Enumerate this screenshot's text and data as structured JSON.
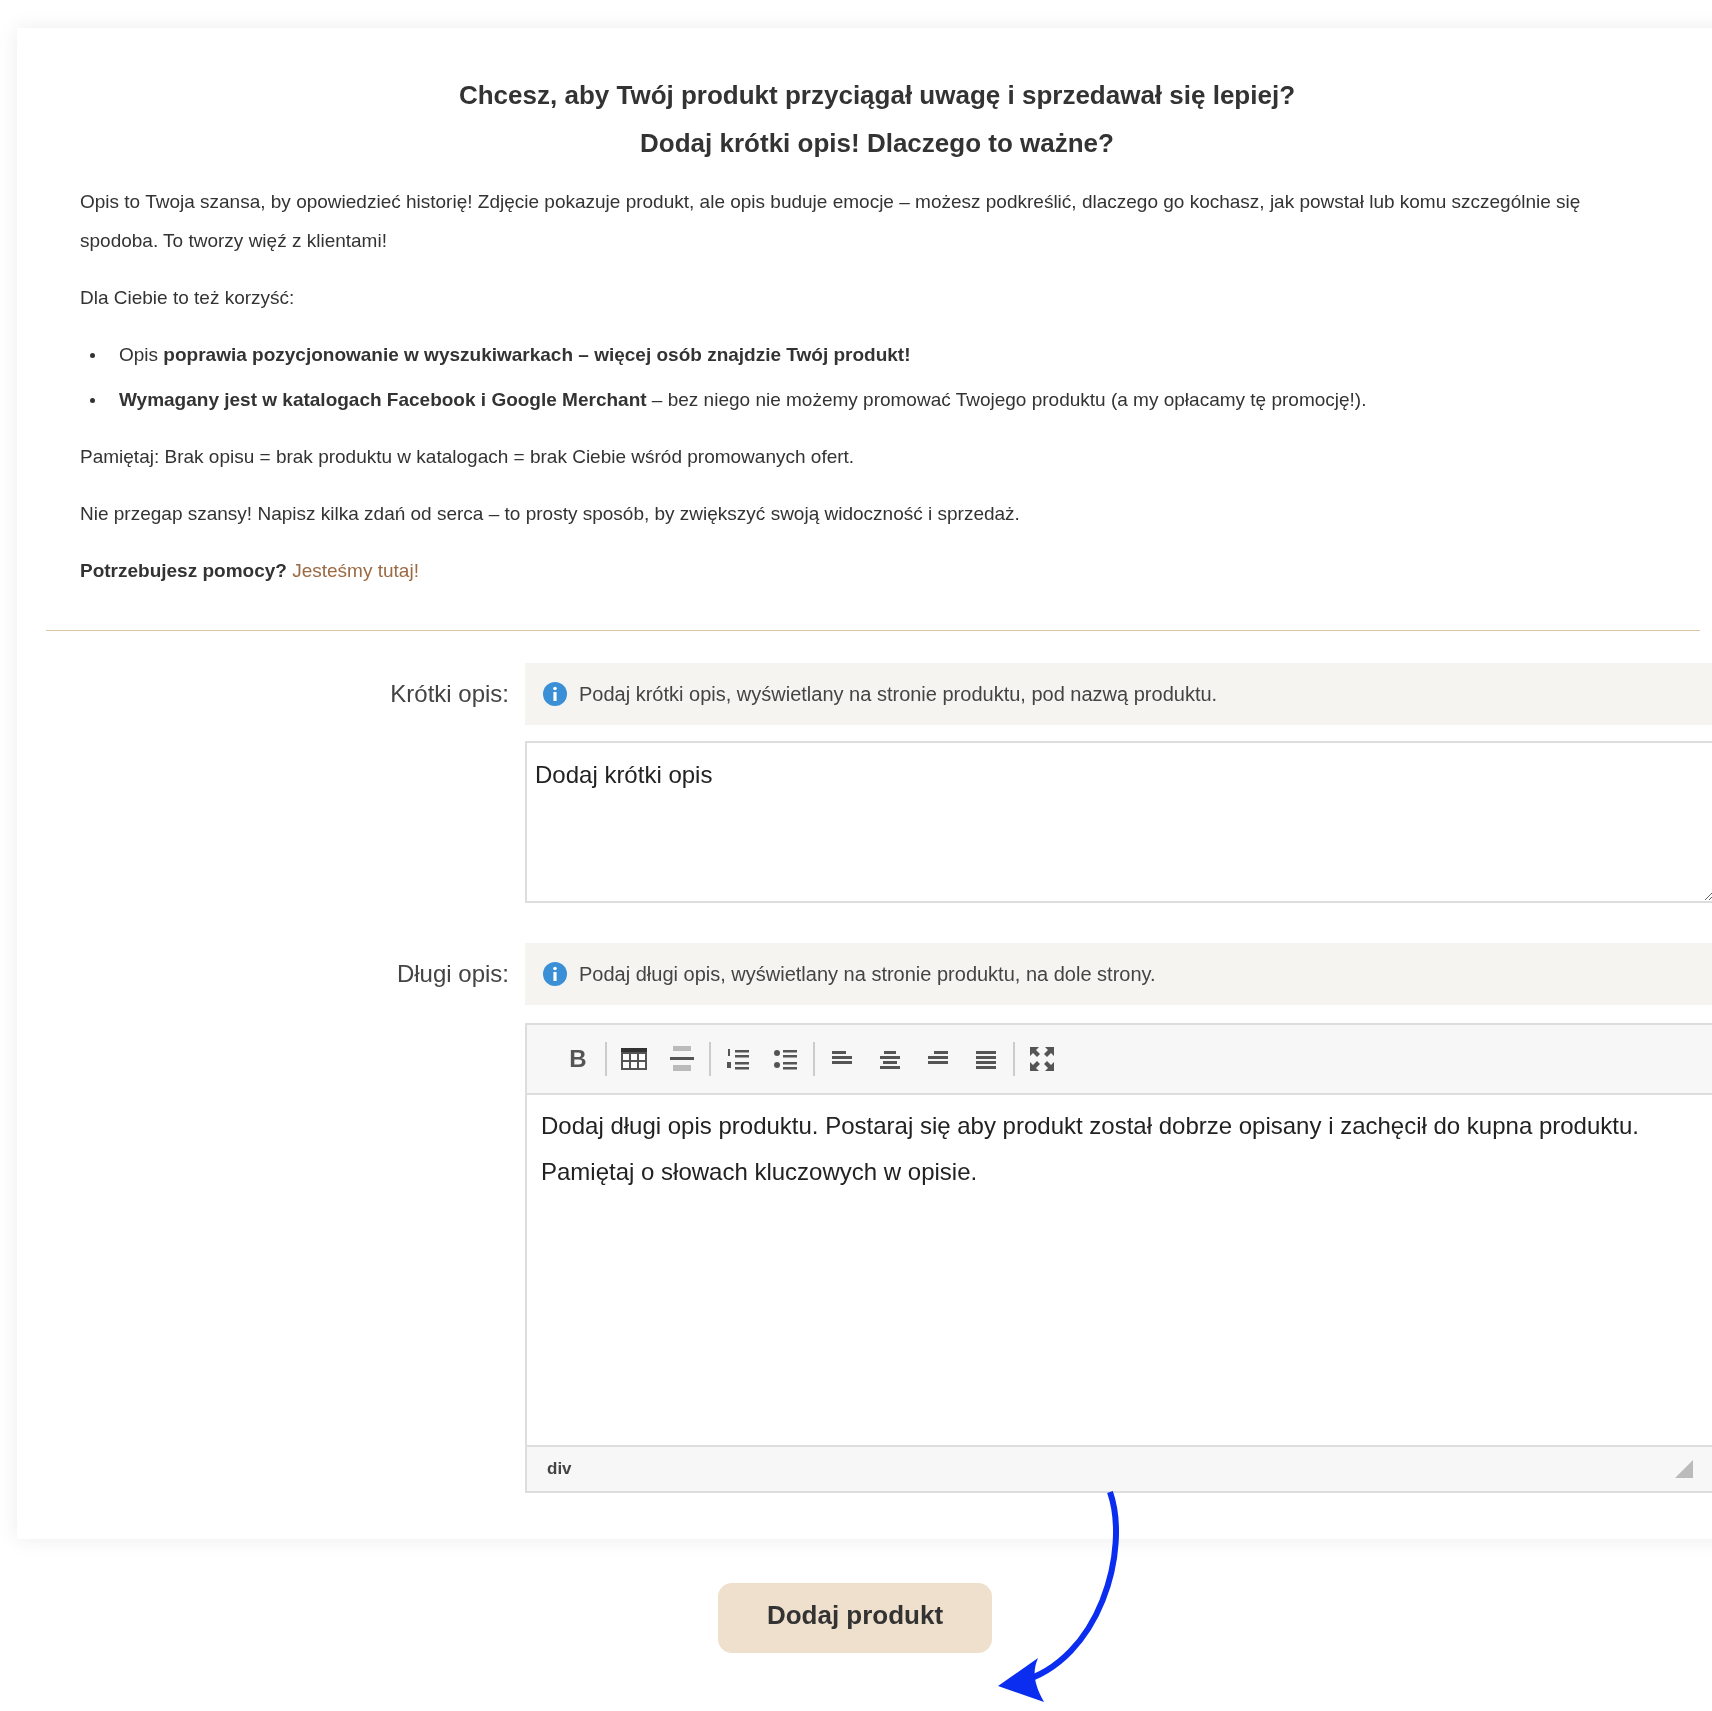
{
  "intro": {
    "heading_lines": [
      "Chcesz, aby Twój produkt przyciągał uwagę i sprzedawał się lepiej?",
      "Dodaj krótki opis! Dlaczego to ważne?"
    ],
    "paragraphs": [
      "Opis to Twoja szansa, by opowiedzieć historię! Zdjęcie pokazuje produkt, ale opis buduje emocje – możesz podkreślić, dlaczego go kochasz, jak powstał lub komu szczególnie się spodoba. To tworzy więź z klientami!",
      "Dla Ciebie to też korzyść:"
    ],
    "bullets": [
      "Opis **poprawia pozycjonowanie w wyszukiwarkach – więcej osób znajdzie Twój produkt!**",
      "**Wymagany jest w katalogach Facebook i Google Merchant** – bez niego nie możemy promować Twojego produktu (a my opłacamy tę promocję!)."
    ],
    "closing": [
      "Pamiętaj: Brak opisu = brak produktu w katalogach = brak Ciebie wśród promowanych ofert.",
      "Nie przegap szansy! Napisz kilka zdań od serca – to prosty sposób, by zwiększyć swoją widoczność i sprzedaż."
    ],
    "help": {
      "text": "Potrzebujesz pomocy?",
      "link": "Jesteśmy tutaj!"
    }
  },
  "short_description": {
    "label": "Krótki opis:",
    "hint": "Podaj krótki opis, wyświetlany na stronie produktu, pod nazwą produktu.",
    "value": "Dodaj krótki opis"
  },
  "long_description": {
    "label": "Długi opis:",
    "hint": "Podaj długi opis, wyświetlany na stronie produktu, na dole strony.",
    "toolbar_groups": [
      [
        {
          "kind": "bold",
          "label": "B"
        }
      ],
      [
        {
          "kind": "table"
        },
        {
          "kind": "rule"
        }
      ],
      [
        {
          "kind": "ordered"
        },
        {
          "kind": "bullets"
        }
      ],
      [
        {
          "kind": "left"
        },
        {
          "kind": "center"
        },
        {
          "kind": "right"
        },
        {
          "kind": "justify"
        }
      ],
      [
        {
          "kind": "fullscreen"
        }
      ]
    ],
    "value": "Dodaj długi opis produktu. Postaraj się aby produkt został dobrze opisany i zachęcił do kupna produktu. Pamiętaj o słowach kluczowych w opisie.",
    "status_path": "div"
  },
  "submit_button": "Dodaj produkt"
}
